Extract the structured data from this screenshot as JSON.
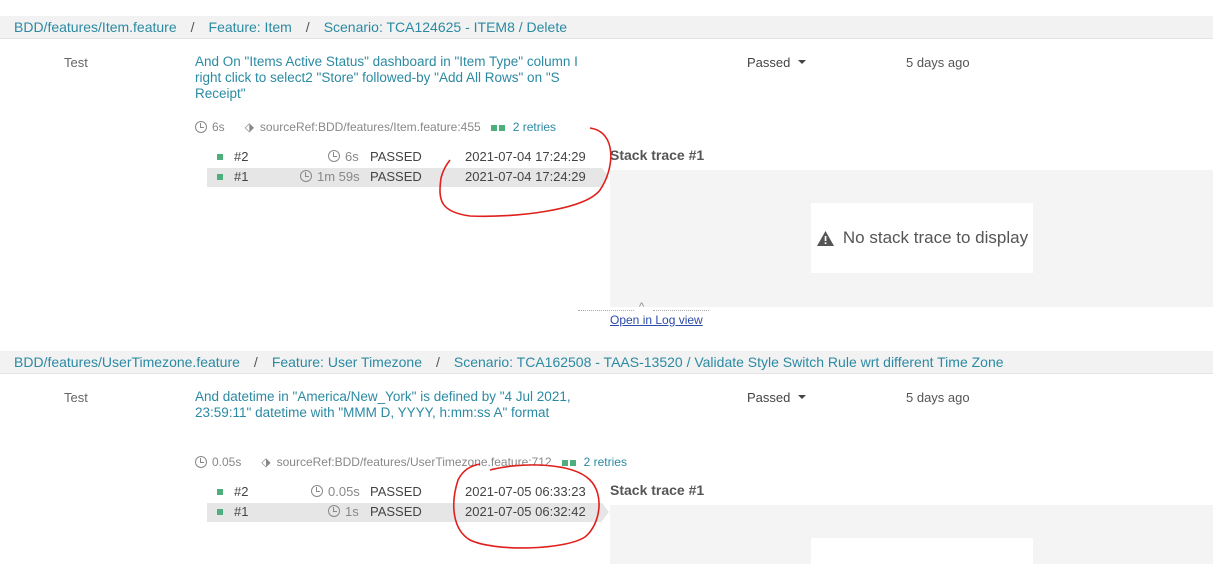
{
  "items": [
    {
      "breadcrumb": [
        "BDD/features/Item.feature",
        "Feature: Item",
        "Scenario: TCA124625 - ITEM8 / Delete"
      ],
      "separator": "/",
      "type": "Test",
      "description": "And On \"Items Active Status\" dashboard in \"Item Type\" column I right click to select2 \"Store\" followed-by \"Add All Rows\" on \"S Receipt\"",
      "duration": "6s",
      "source_ref": "sourceRef:BDD/features/Item.feature:455",
      "retries_label": "2 retries",
      "status": "Passed",
      "age": "5 days ago",
      "retries": [
        {
          "num": "#2",
          "duration": "6s",
          "status": "PASSED",
          "timestamp": "2021-07-04 17:24:29"
        },
        {
          "num": "#1",
          "duration": "1m 59s",
          "status": "PASSED",
          "timestamp": "2021-07-04 17:24:29"
        }
      ],
      "stack_title": "Stack trace #1",
      "no_trace": "No stack trace to display"
    },
    {
      "breadcrumb": [
        "BDD/features/UserTimezone.feature",
        "Feature: User Timezone",
        "Scenario: TCA162508 - TAAS-13520 / Validate Style Switch Rule wrt different Time Zone"
      ],
      "separator": "/",
      "type": "Test",
      "description": "And datetime in \"America/New_York\" is defined by \"4 Jul 2021, 23:59:11\" datetime with \"MMM D, YYYY, h:mm:ss A\" format",
      "duration": "0.05s",
      "source_ref": "sourceRef:BDD/features/UserTimezone.feature:712",
      "retries_label": "2 retries",
      "status": "Passed",
      "age": "5 days ago",
      "retries": [
        {
          "num": "#2",
          "duration": "0.05s",
          "status": "PASSED",
          "timestamp": "2021-07-05 06:33:23"
        },
        {
          "num": "#1",
          "duration": "1s",
          "status": "PASSED",
          "timestamp": "2021-07-05 06:32:42"
        }
      ],
      "stack_title": "Stack trace #1"
    }
  ],
  "open_log_view": "Open in Log view",
  "colors": {
    "link": "#2b8aa3",
    "passed": "#4caf7d",
    "annotation": "#e0201c"
  }
}
